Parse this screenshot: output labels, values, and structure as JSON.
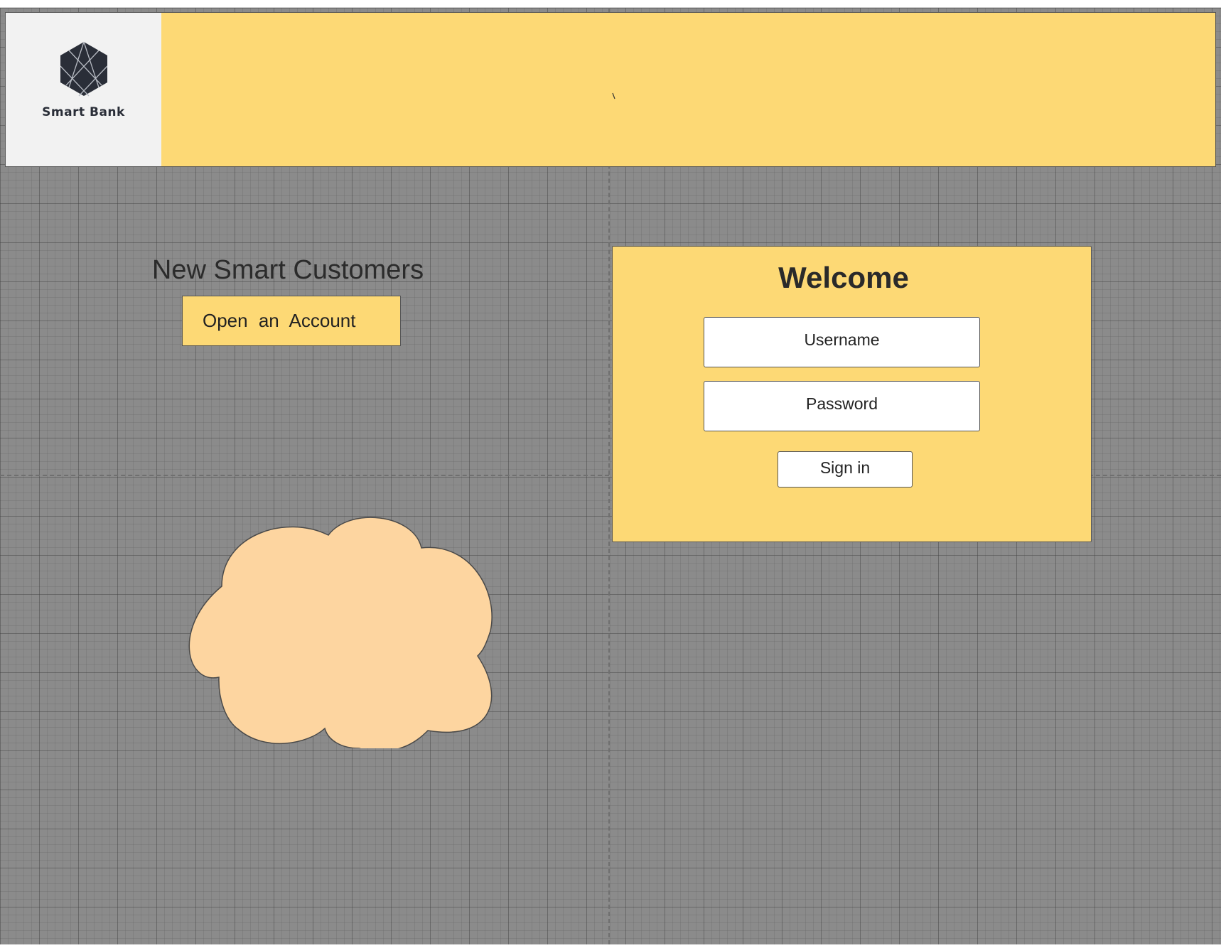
{
  "header": {
    "logo_text": "Smart Bank",
    "logo_icon": "hexagon-logo-icon",
    "background_color": "#fdd975"
  },
  "new_customers": {
    "title": "New Smart Customers",
    "open_account_label": "Open an Account"
  },
  "cloud_shape": {
    "fill_color": "#fdd5a0"
  },
  "login": {
    "title": "Welcome",
    "username_placeholder": "Username",
    "username_value": "",
    "password_placeholder": "Password",
    "password_value": "",
    "signin_label": "Sign in"
  },
  "colors": {
    "accent": "#fdd975",
    "canvas": "#8b8b8b",
    "logo_dark": "#2a2e38"
  }
}
